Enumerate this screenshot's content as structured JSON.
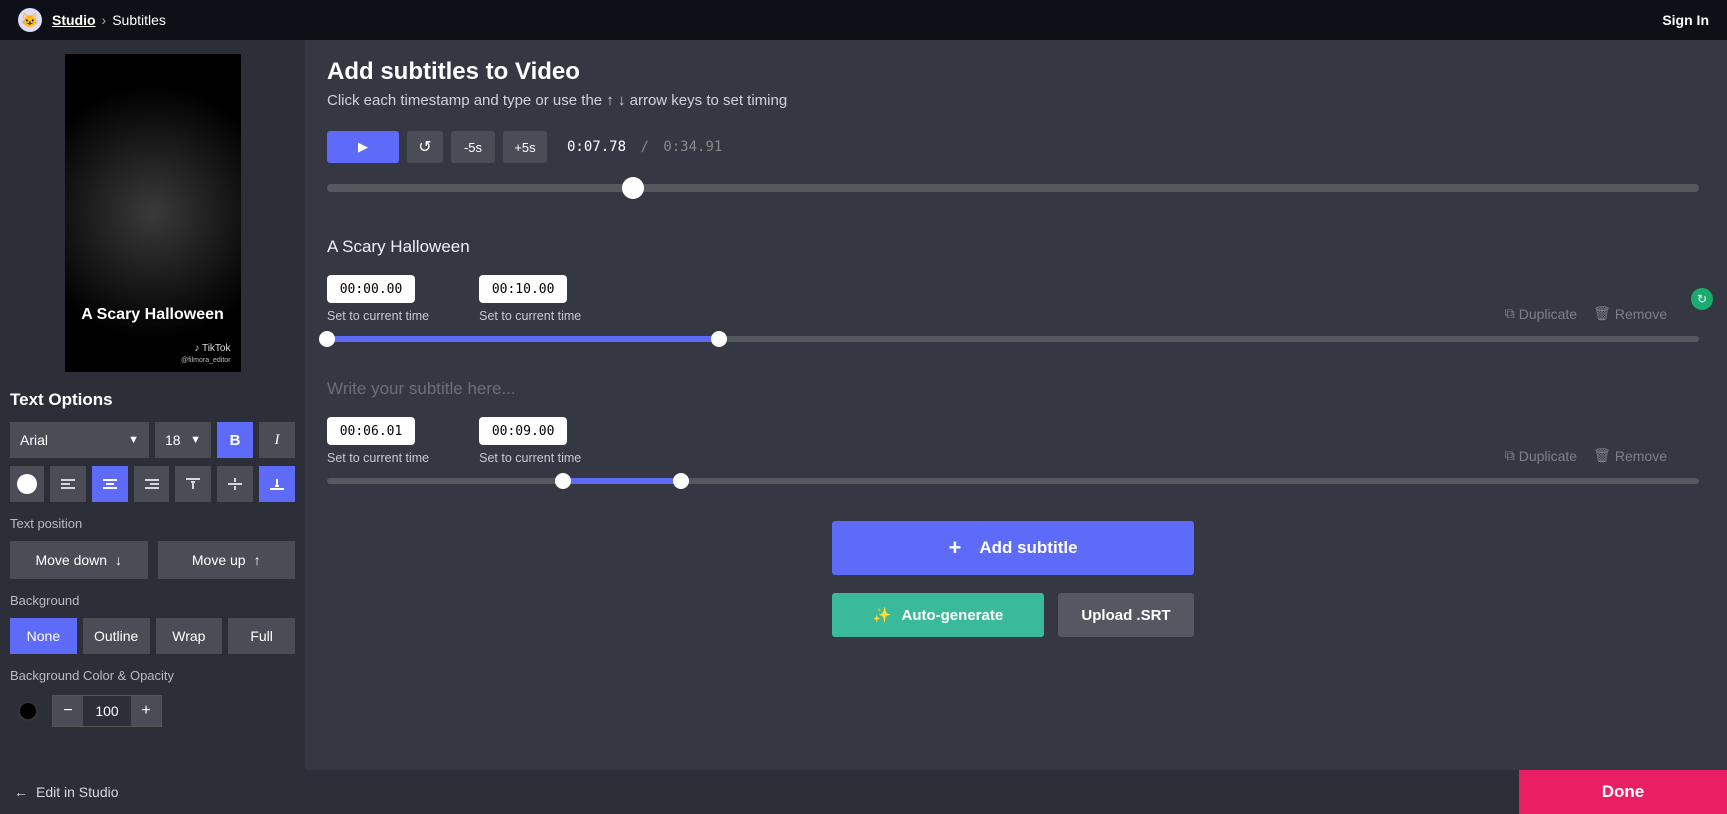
{
  "header": {
    "studio": "Studio",
    "page": "Subtitles",
    "signin": "Sign In"
  },
  "preview": {
    "caption": "A Scary Halloween",
    "watermark": "♪ TikTok",
    "handle": "@filmora_editor"
  },
  "textOptions": {
    "title": "Text Options",
    "font": "Arial",
    "size": "18",
    "bold": "B",
    "italic": "I",
    "positionLabel": "Text position",
    "moveDown": "Move down",
    "moveUp": "Move up",
    "backgroundLabel": "Background",
    "bgNone": "None",
    "bgOutline": "Outline",
    "bgWrap": "Wrap",
    "bgFull": "Full",
    "bgColorLabel": "Background Color & Opacity",
    "opacity": "100"
  },
  "main": {
    "title": "Add subtitles to Video",
    "subtitle": "Click each timestamp and type or use the ↑ ↓ arrow keys to set timing",
    "back5": "-5s",
    "fwd5": "+5s",
    "currentTime": "0:07.78",
    "totalTime": "0:34.91",
    "progressPercent": 22.3
  },
  "subtitles": [
    {
      "text": "A Scary Halloween",
      "start": "00:00.00",
      "end": "00:10.00",
      "setLabel": "Set to current time",
      "rangeStart": 0,
      "rangeEnd": 28.6
    },
    {
      "text": "",
      "placeholder": "Write your subtitle here...",
      "start": "00:06.01",
      "end": "00:09.00",
      "setLabel": "Set to current time",
      "rangeStart": 17.2,
      "rangeEnd": 25.8
    }
  ],
  "actions": {
    "duplicate": "Duplicate",
    "remove": "Remove",
    "addSubtitle": "Add subtitle",
    "autoGenerate": "Auto-generate",
    "uploadSrt": "Upload .SRT"
  },
  "footer": {
    "editInStudio": "Edit in Studio",
    "done": "Done"
  }
}
